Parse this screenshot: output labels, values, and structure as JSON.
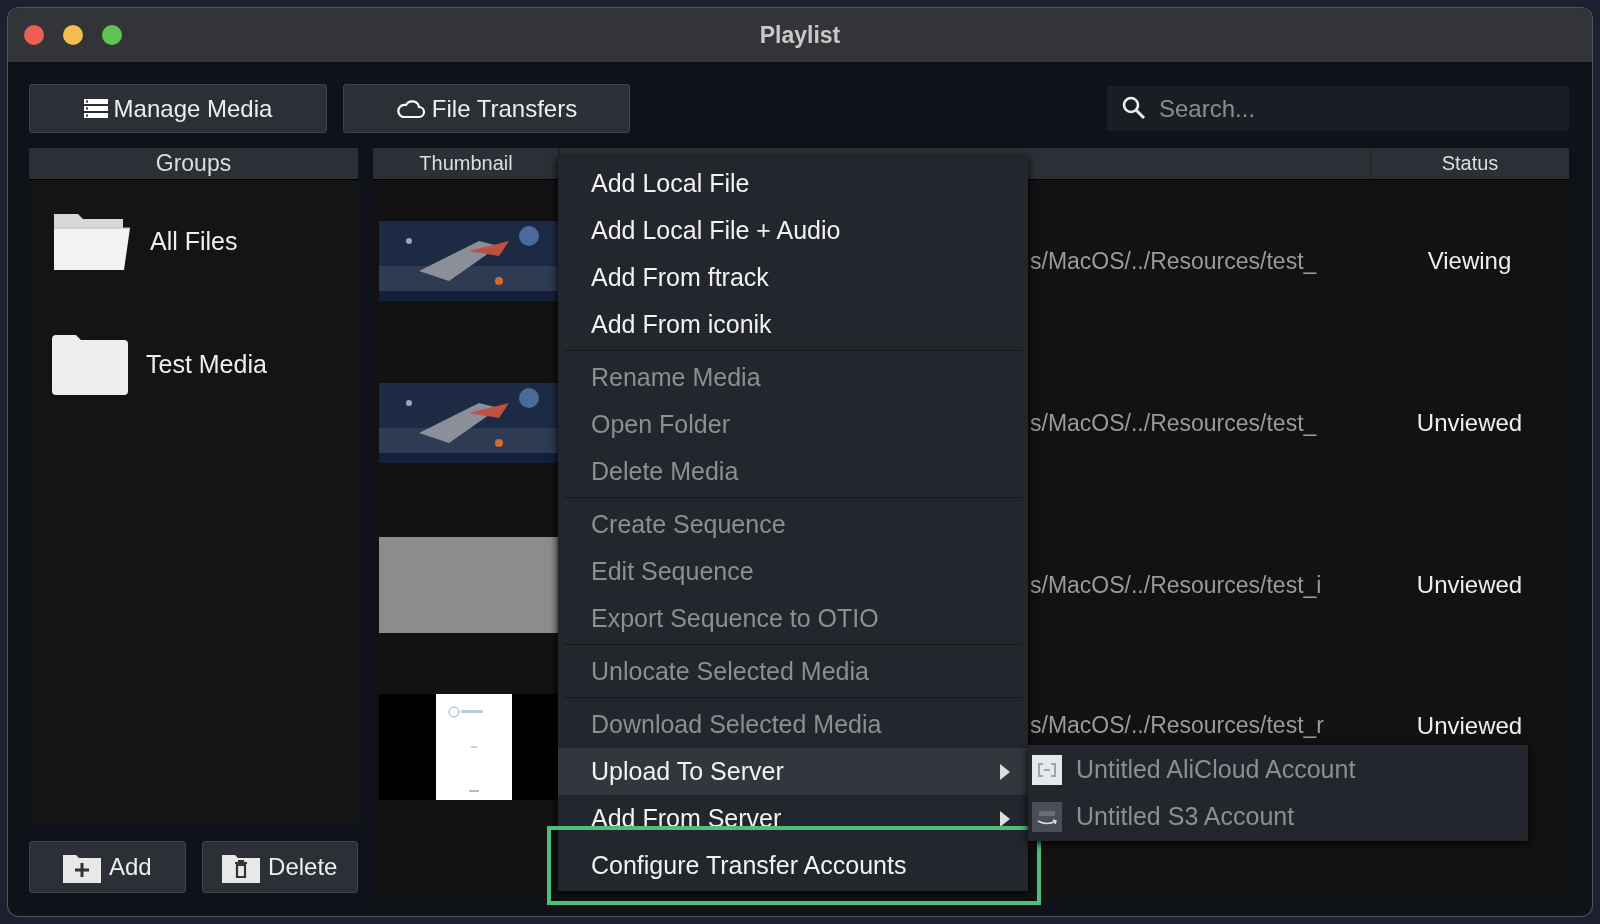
{
  "window": {
    "title": "Playlist"
  },
  "toolbar": {
    "buttons": [
      {
        "label": "Manage Media",
        "kind": "list"
      },
      {
        "label": "File Transfers",
        "kind": "cloud"
      }
    ],
    "search": {
      "placeholder": "Search..."
    }
  },
  "groups": {
    "header": "Groups",
    "items": [
      {
        "label": "All Files",
        "kind": "open"
      },
      {
        "label": "Test Media",
        "kind": "closed"
      }
    ],
    "buttons": [
      {
        "label": "Add",
        "kind": "add"
      },
      {
        "label": "Delete",
        "kind": "delete"
      }
    ]
  },
  "table": {
    "columns": [
      "Thumbnail",
      "Status"
    ],
    "rows": [
      {
        "path": "s/MacOS/../Resources/test_",
        "status": "Viewing"
      },
      {
        "path": "s/MacOS/../Resources/test_",
        "status": "Unviewed"
      },
      {
        "thumbnail": {
          "kind": "blank"
        },
        "path": "s/MacOS/../Resources/test_i",
        "status": "Unviewed"
      },
      {
        "thumbnail": {
          "kind": "document"
        },
        "path": "s/MacOS/../Resources/test_r",
        "status": "Unviewed"
      }
    ]
  },
  "context_menu": {
    "sections": [
      [
        {
          "label": "Add Local File",
          "disabled": false,
          "highlighted": false,
          "submenu": false,
          "outlined": false
        },
        {
          "label": "Add Local File + Audio",
          "disabled": false,
          "highlighted": false,
          "submenu": false,
          "outlined": false
        },
        {
          "label": "Add From ftrack",
          "disabled": false,
          "highlighted": false,
          "submenu": false,
          "outlined": false
        },
        {
          "label": "Add From iconik",
          "disabled": false,
          "highlighted": false,
          "submenu": false,
          "outlined": false
        }
      ],
      [
        {
          "label": "Rename Media",
          "disabled": true,
          "highlighted": false,
          "submenu": false,
          "outlined": false
        },
        {
          "label": "Open Folder",
          "disabled": true,
          "highlighted": false,
          "submenu": false,
          "outlined": false
        },
        {
          "label": "Delete Media",
          "disabled": true,
          "highlighted": false,
          "submenu": false,
          "outlined": false
        }
      ],
      [
        {
          "label": "Create Sequence",
          "disabled": true,
          "highlighted": false,
          "submenu": false,
          "outlined": false
        },
        {
          "label": "Edit Sequence",
          "disabled": true,
          "highlighted": false,
          "submenu": false,
          "outlined": false
        },
        {
          "label": "Export Sequence to OTIO",
          "disabled": true,
          "highlighted": false,
          "submenu": false,
          "outlined": false
        }
      ],
      [
        {
          "label": "Unlocate Selected Media",
          "disabled": true,
          "highlighted": false,
          "submenu": false,
          "outlined": false
        }
      ],
      [
        {
          "label": "Download Selected Media",
          "disabled": true,
          "highlighted": false,
          "submenu": false,
          "outlined": false
        },
        {
          "label": "Upload To Server",
          "disabled": false,
          "highlighted": true,
          "submenu": true,
          "outlined": false
        },
        {
          "label": "Add From Server",
          "disabled": false,
          "highlighted": false,
          "submenu": true,
          "outlined": false
        },
        {
          "label": "Configure Transfer Accounts",
          "disabled": false,
          "highlighted": false,
          "submenu": false,
          "outlined": true
        }
      ]
    ]
  },
  "submenu": {
    "items": [
      {
        "label": "Untitled AliCloud Account",
        "kind": "alicloud",
        "disabled": true
      },
      {
        "label": "Untitled S3 Account",
        "kind": "s3",
        "disabled": true
      }
    ]
  }
}
